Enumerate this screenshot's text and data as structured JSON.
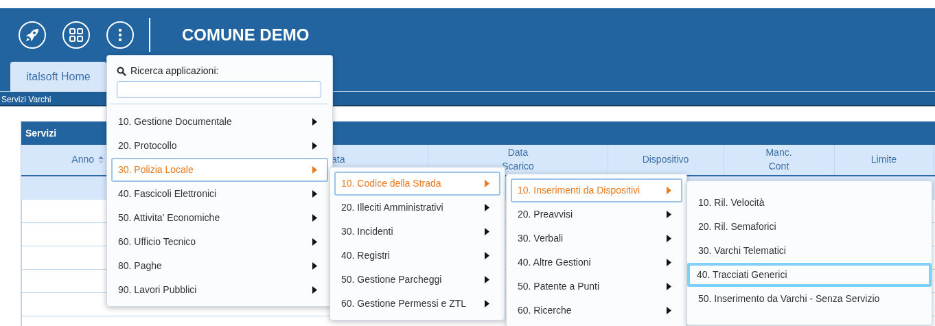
{
  "header": {
    "title": "COMUNE DEMO"
  },
  "tabs": [
    {
      "label": "italsoft Home",
      "selected": true
    }
  ],
  "breadcrumb": "Servizi Varchi",
  "panel": {
    "title": "Servizi",
    "columns": [
      {
        "label": "Anno",
        "sortable": true
      },
      {
        "label": "ata",
        "sortable": false
      },
      {
        "label": "Data Scarico",
        "sortable": false
      },
      {
        "label": "Dispositivo",
        "sortable": false
      },
      {
        "label": "Manc. Cont",
        "sortable": false
      },
      {
        "label": "Limite",
        "sortable": false
      }
    ]
  },
  "menus": [
    {
      "kind": "cascade",
      "search": {
        "label": "Ricerca applicazioni:"
      },
      "items": [
        {
          "label": "10. Gestione Documentale",
          "selected": false
        },
        {
          "label": "20. Protocollo",
          "selected": false
        },
        {
          "label": "30. Polizia Locale",
          "selected": true
        },
        {
          "label": "40. Fascicoli Elettronici",
          "selected": false
        },
        {
          "label": "50. Attivita' Economiche",
          "selected": false
        },
        {
          "label": "60. Ufficio Tecnico",
          "selected": false
        },
        {
          "label": "80. Paghe",
          "selected": false
        },
        {
          "label": "90. Lavori Pubblici",
          "selected": false
        }
      ]
    },
    {
      "kind": "cascade",
      "items": [
        {
          "label": "10. Codice della Strada",
          "selected": true
        },
        {
          "label": "20. Illeciti Amministrativi",
          "selected": false
        },
        {
          "label": "30. Incidenti",
          "selected": false
        },
        {
          "label": "40. Registri",
          "selected": false
        },
        {
          "label": "50. Gestione Parcheggi",
          "selected": false
        },
        {
          "label": "60. Gestione Permessi e ZTL",
          "selected": false
        }
      ]
    },
    {
      "kind": "cascade",
      "items": [
        {
          "label": "10. Inserimenti da Dispositivi",
          "selected": true
        },
        {
          "label": "20. Preavvisi",
          "selected": false
        },
        {
          "label": "30. Verbali",
          "selected": false
        },
        {
          "label": "40. Altre Gestioni",
          "selected": false
        },
        {
          "label": "50. Patente a Punti",
          "selected": false
        },
        {
          "label": "60. Ricerche",
          "selected": false
        }
      ]
    },
    {
      "kind": "leaf",
      "items": [
        {
          "label": "10. Ril. Velocità",
          "selected": false
        },
        {
          "label": "20. Ril. Semaforici",
          "selected": false
        },
        {
          "label": "30. Varchi Telematici",
          "selected": false
        },
        {
          "label": "40. Tracciati Generici",
          "selected": true
        },
        {
          "label": "50. Inserimento da Varchi - Senza Servizio",
          "selected": false
        }
      ]
    }
  ]
}
